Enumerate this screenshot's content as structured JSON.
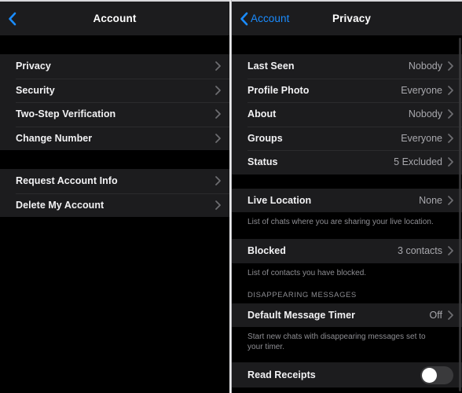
{
  "left_panel": {
    "nav": {
      "title": "Account",
      "back_icon": "chevron-left-icon"
    },
    "sections": [
      {
        "rows": [
          {
            "label": "Privacy",
            "value": "",
            "accessory": "chevron-right-icon"
          },
          {
            "label": "Security",
            "value": "",
            "accessory": "chevron-right-icon"
          },
          {
            "label": "Two-Step Verification",
            "value": "",
            "accessory": "chevron-right-icon"
          },
          {
            "label": "Change Number",
            "value": "",
            "accessory": "chevron-right-icon"
          }
        ]
      },
      {
        "rows": [
          {
            "label": "Request Account Info",
            "value": "",
            "accessory": "chevron-right-icon"
          },
          {
            "label": "Delete My Account",
            "value": "",
            "accessory": "chevron-right-icon"
          }
        ]
      }
    ]
  },
  "right_panel": {
    "nav": {
      "title": "Privacy",
      "back_label": "Account",
      "back_icon": "chevron-left-icon"
    },
    "section1": {
      "rows": [
        {
          "label": "Last Seen",
          "value": "Nobody"
        },
        {
          "label": "Profile Photo",
          "value": "Everyone"
        },
        {
          "label": "About",
          "value": "Nobody"
        },
        {
          "label": "Groups",
          "value": "Everyone"
        },
        {
          "label": "Status",
          "value": "5 Excluded"
        }
      ]
    },
    "live_location": {
      "label": "Live Location",
      "value": "None",
      "footnote": "List of chats where you are sharing your live location."
    },
    "blocked": {
      "label": "Blocked",
      "value": "3 contacts",
      "footnote": "List of contacts you have blocked."
    },
    "disappearing": {
      "header": "DISAPPEARING MESSAGES",
      "label": "Default Message Timer",
      "value": "Off",
      "footnote": "Start new chats with disappearing messages set to your timer."
    },
    "read_receipts": {
      "label": "Read Receipts",
      "toggle_state": "off"
    }
  },
  "colors": {
    "accent": "#1a8cff",
    "row_bg": "#1c1c1e",
    "page_bg": "#000000",
    "value_text": "#a8a8ad"
  }
}
